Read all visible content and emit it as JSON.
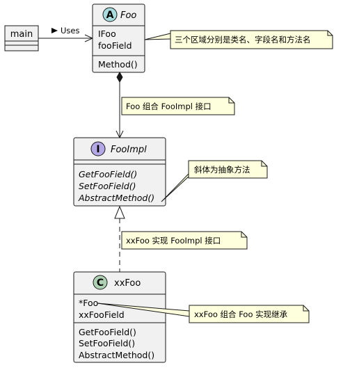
{
  "diagram": {
    "type": "uml-class-diagram",
    "colors": {
      "class_fill": "#F1F1F1",
      "class_stroke": "#181818",
      "note_fill": "#FEFFDD",
      "note_stroke": "#181818",
      "abstract_badge": "#A9DCDF",
      "interface_badge": "#B4A7E5",
      "class_badge": "#ADD1B2",
      "line": "#181818"
    },
    "classes": {
      "main": {
        "name": "main",
        "fields": [],
        "methods": []
      },
      "foo": {
        "kind": "abstract",
        "badge": "A",
        "name": "Foo",
        "fields": [
          "IFoo",
          "fooField"
        ],
        "methods": [
          "Method()"
        ]
      },
      "fooimpl": {
        "kind": "interface",
        "badge": "I",
        "name": "FooImpl",
        "fields": [],
        "methods": [
          "GetFooField()",
          "SetFooField()",
          "AbstractMethod()"
        ]
      },
      "xxfoo": {
        "kind": "class",
        "badge": "C",
        "name": "xxFoo",
        "fields": [
          "*Foo",
          "xxFooField"
        ],
        "methods": [
          "GetFooField()",
          "SetFooField()",
          "AbstractMethod()"
        ]
      }
    },
    "relations": {
      "uses_label": "Uses"
    },
    "notes": {
      "foo_sections": "三个区域分别是类名、字段名和方法名",
      "composition": "Foo 组合 FooImpl 接口",
      "italic_abstract": "斜体为抽象方法",
      "realization": "xxFoo 实现 FooImpl 接口",
      "xxfoo_composition": "xxFoo 组合 Foo 实现继承"
    }
  }
}
